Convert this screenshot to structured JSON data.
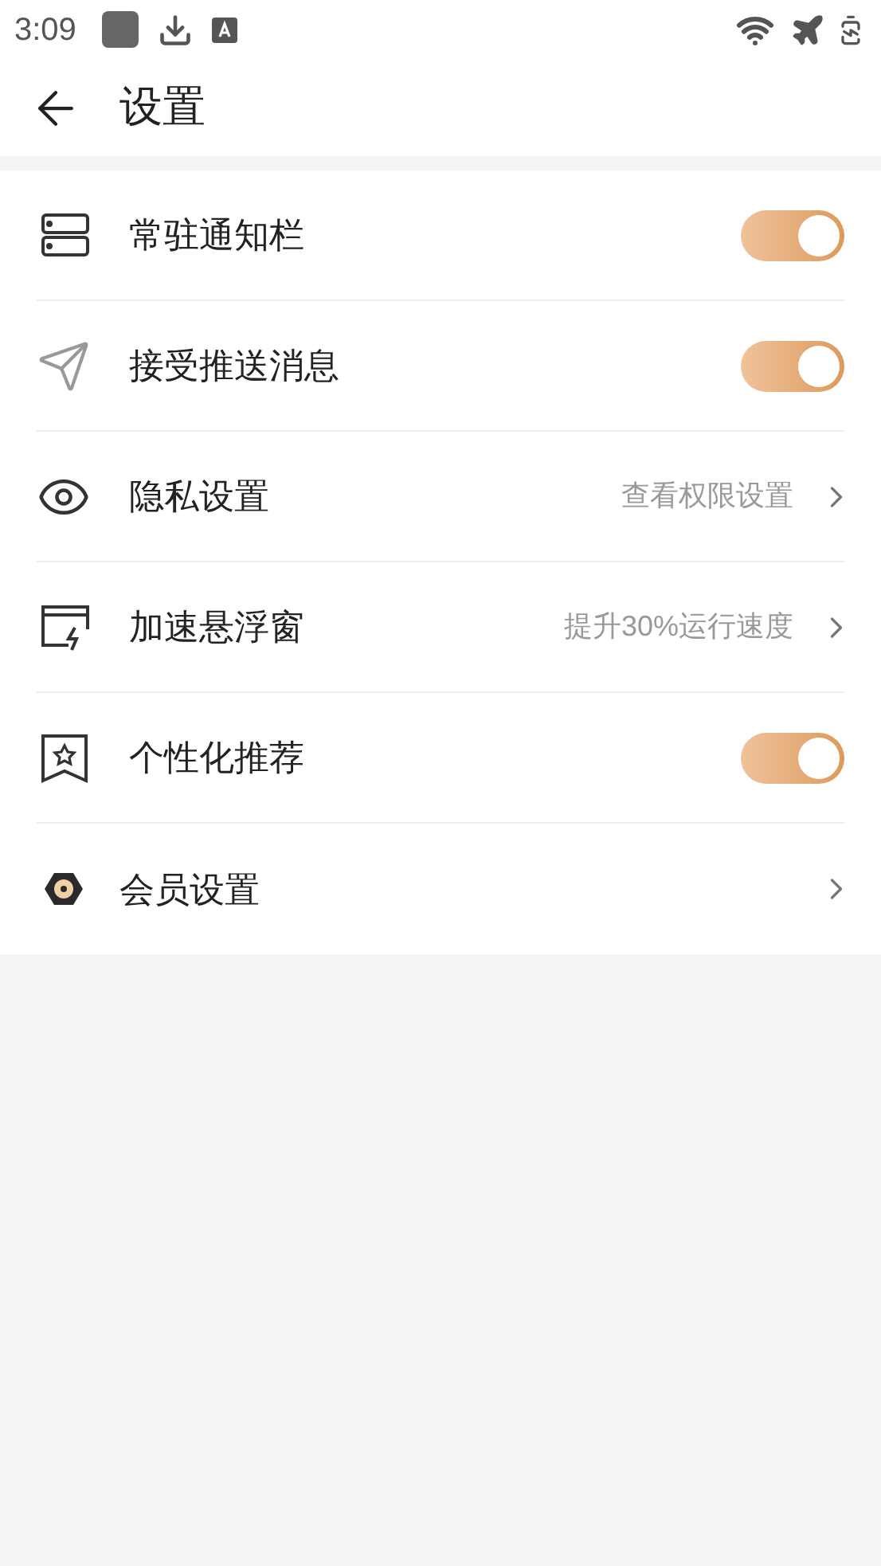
{
  "status_bar": {
    "time": "3:09"
  },
  "header": {
    "title": "设置"
  },
  "settings": [
    {
      "kind": "toggle",
      "label": "常驻通知栏",
      "on": true
    },
    {
      "kind": "toggle",
      "label": "接受推送消息",
      "on": true
    },
    {
      "kind": "link",
      "label": "隐私设置",
      "hint": "查看权限设置"
    },
    {
      "kind": "link",
      "label": "加速悬浮窗",
      "hint": "提升30%运行速度"
    },
    {
      "kind": "toggle",
      "label": "个性化推荐",
      "on": true
    },
    {
      "kind": "link",
      "label": "会员设置"
    }
  ]
}
